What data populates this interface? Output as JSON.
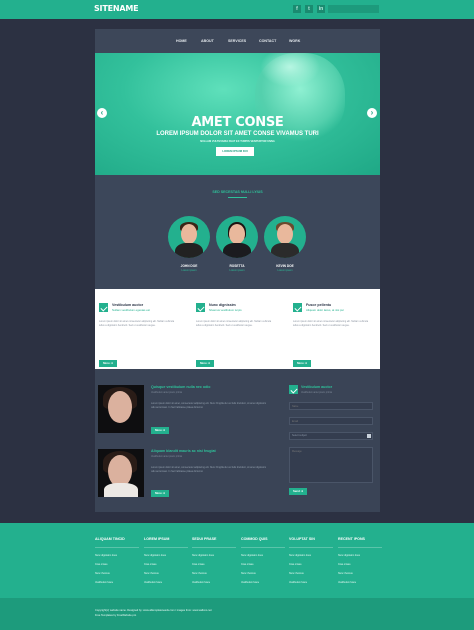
{
  "header": {
    "sitename": "SITENAME",
    "social": [
      "f",
      "t",
      "in"
    ],
    "search_placeholder": ""
  },
  "nav": {
    "items": [
      "HOME",
      "ABOUT",
      "SERVICES",
      "CONTACT",
      "WORK"
    ]
  },
  "hero": {
    "title": "AMET CONSE",
    "subtitle": "LOREM IPSUM DOLOR SIT AMET CONSE VIVAMUS TURI",
    "tagline": "NULLAM VULTEVARIA FEAT EX TURPIS VESPURTOR UNNA",
    "button": "LOREM IPSUM DUI",
    "prev": "‹",
    "next": "›"
  },
  "team": {
    "title": "SED SECESTAS NULLI LYIUS",
    "members": [
      {
        "name": "JOHN DOE",
        "role": "Lorem ipsum"
      },
      {
        "name": "ROSETTA",
        "role": "Lorem ipsum"
      },
      {
        "name": "KEVIN DOE",
        "role": "Lorem ipsum"
      }
    ]
  },
  "features": [
    {
      "title": "Vestibulum auctor",
      "subtitle": "Nullam vestibulum egestas est",
      "text": "Lorem ipsum dolor sit amet consectetur adipiscing elit. Nullam vehicula tellus a dignissim hendrerit. Sed ut vestibulum augue.",
      "button": "More ➔"
    },
    {
      "title": "Nunc dignissim",
      "subtitle": "Nivamus vestibulum turpis",
      "text": "Lorem ipsum dolor sit amet consectetur adipiscing elit. Nullam vehicula tellus a dignissim hendrerit. Sed ut vestibulum augue.",
      "button": "More ➔"
    },
    {
      "title": "Fusce pellentu",
      "subtitle": "Aliquam dolor lacus, at nisi pur",
      "text": "Lorem ipsum dolor sit amet consectetur adipiscing elit. Nullam vehicula tellus a dignissim hendrerit. Sed ut vestibulum augue.",
      "button": "More ➔"
    }
  ],
  "posts": [
    {
      "title": "Quisque vestibulum nulla nec odio",
      "subtitle": "Vestibulum ante ipsum primis",
      "text": "Lorem ipsum dolor sit amet, consectetur adipiscing elit. Nunc fringilla dui vel felis tincidunt, sit amet dignissim odio accumsan. In hac habitasse platea dictumst.",
      "button": "More ➔"
    },
    {
      "title": "Aliquam blandit mauris ac nisi feugiat",
      "subtitle": "Vestibulum ante ipsum primis",
      "text": "Lorem ipsum dolor sit amet, consectetur adipiscing elit. Nunc fringilla dui vel felis tincidunt, sit amet dignissim odio accumsan. In hac habitasse platea dictumst.",
      "button": "More ➔"
    }
  ],
  "contact": {
    "title": "Vestibulum auctor",
    "subtitle": "Vestibulum ante ipsum primis",
    "name_placeholder": "Name",
    "email_placeholder": "Email",
    "subject_value": "Select subject",
    "message_placeholder": "Message",
    "send": "Send ➔"
  },
  "footer": {
    "columns": [
      {
        "title": "ALIQUAM TINCID",
        "items": [
          "Nunc dignissim risus",
          "Cras ornare",
          "Nunc rhoncus",
          "Vestibulum fusce"
        ]
      },
      {
        "title": "LOREM IPSUM",
        "items": [
          "Nunc dignissim risus",
          "Cras ornare",
          "Nunc rhoncus",
          "Vestibulum fusce"
        ]
      },
      {
        "title": "SEDUI PRASE",
        "items": [
          "Nunc dignissim risus",
          "Cras ornare",
          "Nunc rhoncus",
          "Vestibulum fusce"
        ]
      },
      {
        "title": "COMMOD QUIS",
        "items": [
          "Nunc dignissim risus",
          "Cras ornare",
          "Nunc rhoncus",
          "Vestibulum fusce"
        ]
      },
      {
        "title": "VOLUPTAT SIN",
        "items": [
          "Nunc dignissim risus",
          "Cras ornare",
          "Nunc rhoncus",
          "Vestibulum fusce"
        ]
      },
      {
        "title": "RECENT IPONS",
        "items": [
          "Nunc dignissim risus",
          "Cras ornare",
          "Nunc rhoncus",
          "Vestibulum fusce"
        ]
      }
    ],
    "copyright_line1": "Copyright(c) website name. Designed by: www.alltemplateneeds.com / images from: www.wallcoo.net",
    "copyright_line2": "Free Templates by FreeWebsite.pro"
  },
  "colors": {
    "accent": "#23b08e",
    "background": "#2c3142",
    "panel": "#3e4a5d"
  }
}
